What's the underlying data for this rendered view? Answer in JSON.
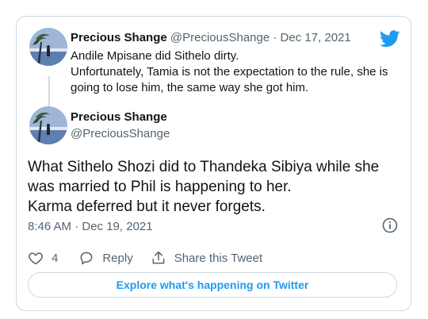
{
  "parent_tweet": {
    "author_name": "Precious Shange",
    "author_handle": "@PreciousShange",
    "separator": "·",
    "date": "Dec 17, 2021",
    "text_lines": [
      "Andile Mpisane did Sithelo dirty.",
      "Unfortunately, Tamia is not the expectation to the rule, she is going to lose him, the same way she got him."
    ]
  },
  "main_tweet": {
    "author_name": "Precious Shange",
    "author_handle": "@PreciousShange",
    "text_lines": [
      "What Sithelo Shozi did to Thandeka Sibiya while she",
      "was married to Phil is happening to her.",
      "Karma deferred but it never forgets."
    ],
    "timestamp": "8:46 AM · Dec 19, 2021"
  },
  "actions": {
    "like_count": "4",
    "reply_label": "Reply",
    "share_label": "Share this Tweet"
  },
  "explore_button": "Explore what's happening on Twitter",
  "icons": {
    "brand": "twitter-bird-icon",
    "info": "info-icon",
    "like": "heart-icon",
    "reply": "reply-icon",
    "share": "share-icon"
  },
  "colors": {
    "brand_blue": "#1d9bf0",
    "text": "#0f1419",
    "muted": "#536471",
    "border": "#cfd9de"
  }
}
